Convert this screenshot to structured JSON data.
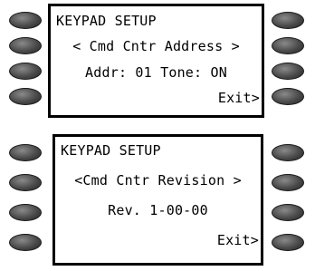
{
  "screens": [
    {
      "title": "KEYPAD SETUP",
      "menu_item": "< Cmd Cntr Address >",
      "value_line": "Addr: 01 Tone: ON",
      "exit_label": "Exit>"
    },
    {
      "title": "KEYPAD SETUP",
      "menu_item": "<Cmd Cntr Revision >",
      "value_line": "Rev. 1-00-00",
      "exit_label": "Exit>"
    }
  ]
}
